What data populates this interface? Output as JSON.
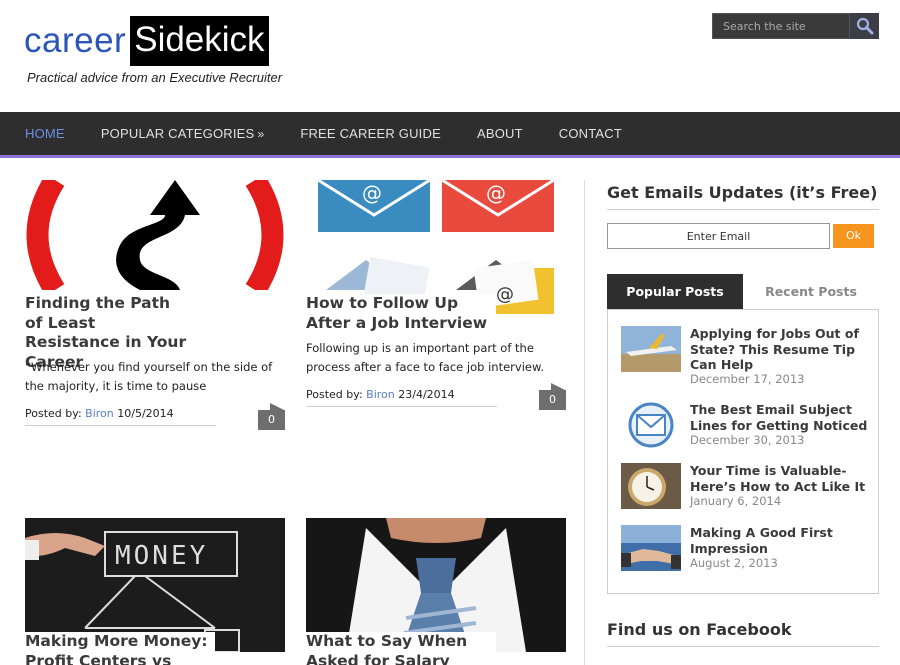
{
  "header": {
    "logo_career": "career",
    "logo_sidekick": "Sidekick",
    "tagline": "Practical advice from an Executive Recruiter",
    "search_placeholder": "Search the site"
  },
  "nav": {
    "items": [
      "HOME",
      "POPULAR CATEGORIES",
      "FREE CAREER GUIDE",
      "ABOUT",
      "CONTACT"
    ],
    "dropdown_marker": "»",
    "active_color": "#6c8fe6"
  },
  "posts": [
    {
      "title": "Finding the Path of Least Resistance in Your Career",
      "excerpt": "“Whenever you find yourself on the side of the majority, it is time to pause",
      "meta_prefix": "Posted by:",
      "author": "Biron",
      "date": "10/5/2014",
      "comments": "0"
    },
    {
      "title": "How to Follow Up After a Job Interview",
      "excerpt": "Following up is an important part of the process after a face to face job interview.",
      "meta_prefix": "Posted by:",
      "author": "Biron",
      "date": "23/4/2014",
      "comments": "0"
    },
    {
      "title": "Making More Money: Profit Centers vs Cost",
      "thumb_text": "MONEY"
    },
    {
      "title": "What to Say When Asked for Salary"
    }
  ],
  "sidebar": {
    "email_heading": "Get Emails Updates (it’s Free)",
    "email_placeholder": "Enter Email",
    "ok_label": "Ok",
    "tabs": [
      "Popular Posts",
      "Recent Posts"
    ],
    "popular": [
      {
        "title": "Applying for Jobs Out of State? This Resume Tip Can Help",
        "date": "December 17, 2013"
      },
      {
        "title": "The Best Email Subject Lines for Getting Noticed",
        "date": "December 30, 2013"
      },
      {
        "title": "Your Time is Valuable- Here’s How to Act Like It",
        "date": "January 6, 2014"
      },
      {
        "title": "Making A Good First Impression",
        "date": "August 2, 2013"
      }
    ],
    "facebook_heading": "Find us on Facebook"
  }
}
